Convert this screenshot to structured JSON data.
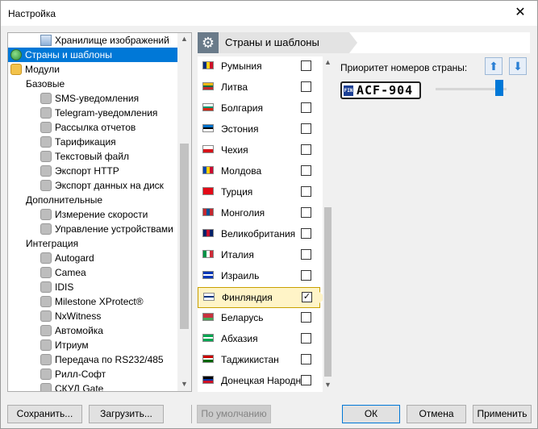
{
  "window": {
    "title": "Настройка",
    "close_glyph": "✕"
  },
  "tree": {
    "items": [
      {
        "label": "Хранилище изображений",
        "level": 2,
        "icon": "image-storage-icon"
      },
      {
        "label": "Страны и шаблоны",
        "level": 0,
        "icon": "globe-icon",
        "selected": true
      },
      {
        "label": "Модули",
        "level": 0,
        "icon": "puzzle-icon"
      },
      {
        "label": "Базовые",
        "level": 1
      },
      {
        "label": "SMS-уведомления",
        "level": 2,
        "icon": "puzzle-icon"
      },
      {
        "label": "Telegram-уведомления",
        "level": 2,
        "icon": "puzzle-icon"
      },
      {
        "label": "Рассылка отчетов",
        "level": 2,
        "icon": "puzzle-icon"
      },
      {
        "label": "Тарификация",
        "level": 2,
        "icon": "puzzle-icon"
      },
      {
        "label": "Текстовый файл",
        "level": 2,
        "icon": "puzzle-icon"
      },
      {
        "label": "Экспорт HTTP",
        "level": 2,
        "icon": "puzzle-icon"
      },
      {
        "label": "Экспорт данных на диск",
        "level": 2,
        "icon": "puzzle-icon"
      },
      {
        "label": "Дополнительные",
        "level": 1
      },
      {
        "label": "Измерение скорости",
        "level": 2,
        "icon": "puzzle-icon"
      },
      {
        "label": "Управление устройствами",
        "level": 2,
        "icon": "puzzle-icon"
      },
      {
        "label": "Интеграция",
        "level": 1
      },
      {
        "label": "Autogard",
        "level": 2,
        "icon": "puzzle-icon"
      },
      {
        "label": "Camea",
        "level": 2,
        "icon": "puzzle-icon"
      },
      {
        "label": "IDIS",
        "level": 2,
        "icon": "puzzle-icon"
      },
      {
        "label": "Milestone XProtect®",
        "level": 2,
        "icon": "puzzle-icon"
      },
      {
        "label": "NxWitness",
        "level": 2,
        "icon": "puzzle-icon"
      },
      {
        "label": "Автомойка",
        "level": 2,
        "icon": "puzzle-icon"
      },
      {
        "label": "Итриум",
        "level": 2,
        "icon": "puzzle-icon"
      },
      {
        "label": "Передача по RS232/485",
        "level": 2,
        "icon": "puzzle-icon"
      },
      {
        "label": "Рилл-Софт",
        "level": 2,
        "icon": "puzzle-icon"
      },
      {
        "label": "СКУД Gate",
        "level": 2,
        "icon": "puzzle-icon"
      }
    ]
  },
  "header": {
    "title": "Страны и шаблоны"
  },
  "countries": [
    {
      "name": "Румыния",
      "checked": false,
      "flag": [
        "#002b7f",
        "#fcd116",
        "#ce1126"
      ],
      "orient": "v"
    },
    {
      "name": "Литва",
      "checked": false,
      "flag": [
        "#fdb913",
        "#006a44",
        "#c1272d"
      ],
      "orient": "h"
    },
    {
      "name": "Болгария",
      "checked": false,
      "flag": [
        "#ffffff",
        "#00966e",
        "#d62612"
      ],
      "orient": "h"
    },
    {
      "name": "Эстония",
      "checked": false,
      "flag": [
        "#0072ce",
        "#000000",
        "#ffffff"
      ],
      "orient": "h"
    },
    {
      "name": "Чехия",
      "checked": false,
      "flag": [
        "#ffffff",
        "#d7141a"
      ],
      "orient": "h"
    },
    {
      "name": "Молдова",
      "checked": false,
      "flag": [
        "#0046ae",
        "#ffd200",
        "#cc092f"
      ],
      "orient": "v"
    },
    {
      "name": "Турция",
      "checked": false,
      "flag": [
        "#e30a17"
      ],
      "orient": "h"
    },
    {
      "name": "Монголия",
      "checked": false,
      "flag": [
        "#c4272f",
        "#015197",
        "#c4272f"
      ],
      "orient": "v"
    },
    {
      "name": "Великобритания",
      "checked": false,
      "flag": [
        "#012169",
        "#c8102e",
        "#012169"
      ],
      "orient": "v"
    },
    {
      "name": "Италия",
      "checked": false,
      "flag": [
        "#009246",
        "#ffffff",
        "#ce2b37"
      ],
      "orient": "v"
    },
    {
      "name": "Израиль",
      "checked": false,
      "flag": [
        "#0038b8",
        "#ffffff",
        "#0038b8"
      ],
      "orient": "h"
    },
    {
      "name": "Финляндия",
      "checked": true,
      "flag": [
        "#ffffff",
        "#003580",
        "#ffffff"
      ],
      "orient": "h",
      "selected": true
    },
    {
      "name": "Беларусь",
      "checked": false,
      "flag": [
        "#c8313e",
        "#c8313e",
        "#4aa657"
      ],
      "orient": "h"
    },
    {
      "name": "Абхазия",
      "checked": false,
      "flag": [
        "#00a651",
        "#ffffff",
        "#00a651"
      ],
      "orient": "h"
    },
    {
      "name": "Таджикистан",
      "checked": false,
      "flag": [
        "#cc0000",
        "#ffffff",
        "#006600"
      ],
      "orient": "h"
    },
    {
      "name": "Донецкая Народн",
      "checked": false,
      "flag": [
        "#000000",
        "#0038a8",
        "#ce1126"
      ],
      "orient": "h"
    }
  ],
  "right": {
    "priority_label": "Приоритет номеров страны:",
    "plate_text": "ACF-904",
    "plate_country_code": "FIN",
    "priority_level": 0.9
  },
  "buttons": {
    "save": "Сохранить...",
    "load": "Загрузить...",
    "defaults": "По умолчанию",
    "ok": "ОК",
    "cancel": "Отмена",
    "apply": "Применить"
  }
}
